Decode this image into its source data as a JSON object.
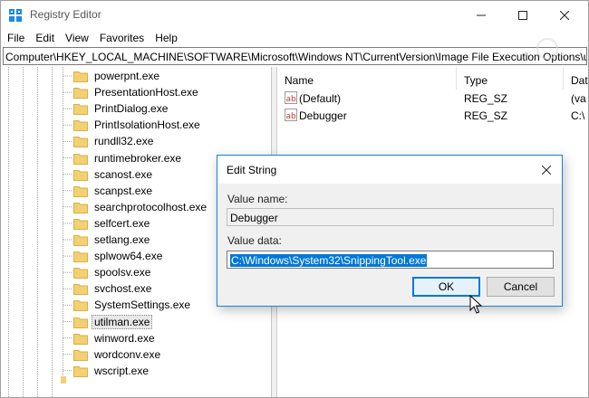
{
  "window": {
    "title": "Registry Editor",
    "controls": {
      "minimize": "minimize",
      "maximize": "maximize",
      "close": "close"
    }
  },
  "menu": [
    "File",
    "Edit",
    "View",
    "Favorites",
    "Help"
  ],
  "address": "Computer\\HKEY_LOCAL_MACHINE\\SOFTWARE\\Microsoft\\Windows NT\\CurrentVersion\\Image File Execution Options\\utilman.exe",
  "tree": {
    "items": [
      "powerpnt.exe",
      "PresentationHost.exe",
      "PrintDialog.exe",
      "PrintIsolationHost.exe",
      "rundll32.exe",
      "runtimebroker.exe",
      "scanost.exe",
      "scanpst.exe",
      "searchprotocolhost.exe",
      "selfcert.exe",
      "setlang.exe",
      "splwow64.exe",
      "spoolsv.exe",
      "svchost.exe",
      "SystemSettings.exe",
      "utilman.exe",
      "winword.exe",
      "wordconv.exe",
      "wscript.exe"
    ],
    "selected": "utilman.exe"
  },
  "list": {
    "columns": {
      "name": "Name",
      "type": "Type",
      "data": "Dat"
    },
    "rows": [
      {
        "name": "(Default)",
        "type": "REG_SZ",
        "data": "(va"
      },
      {
        "name": "Debugger",
        "type": "REG_SZ",
        "data": "C:\\"
      }
    ]
  },
  "dialog": {
    "title": "Edit String",
    "value_name_label": "Value name:",
    "value_name": "Debugger",
    "value_data_label": "Value data:",
    "value_data": "C:\\Windows\\System32\\SnippingTool.exe",
    "ok_label": "OK",
    "cancel_label": "Cancel"
  },
  "colors": {
    "accent": "#0078d7",
    "folder": "#f3d071",
    "selection": "#0078d7"
  }
}
